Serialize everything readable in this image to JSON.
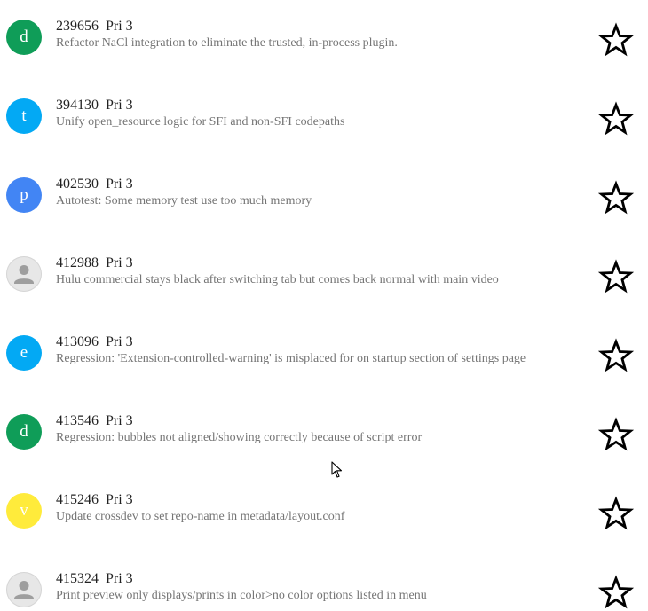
{
  "issues": [
    {
      "id": "239656",
      "priority": "Pri 3",
      "summary": "Refactor NaCl integration to eliminate the trusted, in-process plugin.",
      "avatar_letter": "d",
      "avatar_color": "#0f9d58",
      "avatar_icon": null
    },
    {
      "id": "394130",
      "priority": "Pri 3",
      "summary": "Unify open_resource logic for SFI and non-SFI codepaths",
      "avatar_letter": "t",
      "avatar_color": "#03a9f4",
      "avatar_icon": null
    },
    {
      "id": "402530",
      "priority": "Pri 3",
      "summary": "Autotest: Some memory test use too much memory",
      "avatar_letter": "p",
      "avatar_color": "#4285f4",
      "avatar_icon": null
    },
    {
      "id": "412988",
      "priority": "Pri 3",
      "summary": "Hulu commercial stays black after switching tab but comes back normal with main video",
      "avatar_letter": "",
      "avatar_color": "#e7e7e7",
      "avatar_icon": "person-icon"
    },
    {
      "id": "413096",
      "priority": "Pri 3",
      "summary": "Regression: 'Extension-controlled-warning' is misplaced for on startup section of settings page",
      "avatar_letter": "e",
      "avatar_color": "#03a9f4",
      "avatar_icon": null
    },
    {
      "id": "413546",
      "priority": "Pri 3",
      "summary": "Regression: bubbles not aligned/showing correctly because of script error",
      "avatar_letter": "d",
      "avatar_color": "#0f9d58",
      "avatar_icon": null
    },
    {
      "id": "415246",
      "priority": "Pri 3",
      "summary": "Update crossdev to set repo-name in metadata/layout.conf",
      "avatar_letter": "v",
      "avatar_color": "#ffeb3b",
      "avatar_icon": null
    },
    {
      "id": "415324",
      "priority": "Pri 3",
      "summary": "Print preview only displays/prints in color>no color options listed in menu",
      "avatar_letter": "",
      "avatar_color": "#e7e7e7",
      "avatar_icon": "person-icon"
    }
  ],
  "star_icon": "star-outline-icon",
  "cursor_icon": "mouse-pointer-icon"
}
